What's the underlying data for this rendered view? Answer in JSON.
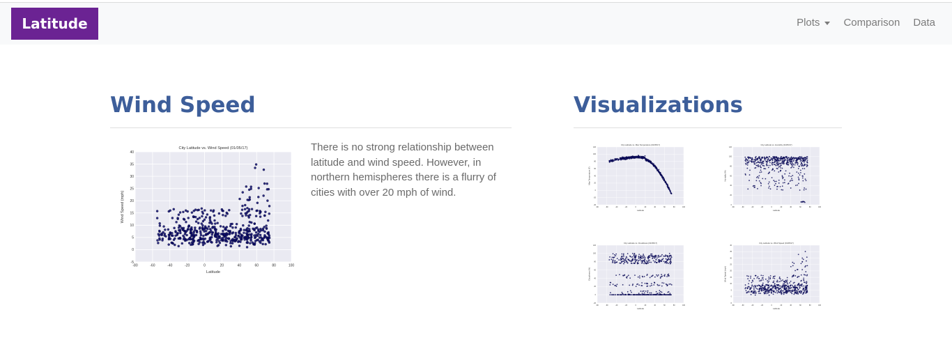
{
  "navbar": {
    "brand": "Latitude",
    "links": [
      {
        "label": "Plots",
        "dropdown": true
      },
      {
        "label": "Comparison",
        "dropdown": false
      },
      {
        "label": "Data",
        "dropdown": false
      }
    ]
  },
  "wind_section": {
    "heading": "Wind Speed",
    "description": "There is no strong relationship between latitude and wind speed. However, in northern hemispheres there is a flurry of cities with over 20 mph of wind."
  },
  "visualizations_section": {
    "heading": "Visualizations"
  },
  "colors": {
    "brand_bg": "#6b2393",
    "heading": "#3d5e9a",
    "plot_bg": "#eaeaf2",
    "marker": "#0b0b6e"
  },
  "chart_data": [
    {
      "id": "wind-main",
      "type": "scatter",
      "title": "City Latitude vs. Wind Speed (01/05/17)",
      "xlabel": "Latitude",
      "ylabel": "Wind Speed (mph)",
      "xlim": [
        -80,
        100
      ],
      "ylim": [
        -5,
        40
      ],
      "xticks": [
        "-80",
        "-60",
        "-40",
        "-20",
        "0",
        "20",
        "40",
        "60",
        "80",
        "100"
      ],
      "yticks": [
        "-5",
        "0",
        "5",
        "10",
        "15",
        "20",
        "25",
        "30",
        "35",
        "40"
      ],
      "grid": true,
      "pattern": "wind"
    },
    {
      "id": "temp-thumb",
      "type": "scatter",
      "title": "City Latitude vs. Max Temperature (01/05/17)",
      "xlabel": "Latitude",
      "ylabel": "Max Temperature (F)",
      "xlim": [
        -80,
        100
      ],
      "ylim": [
        -40,
        120
      ],
      "xticks": [
        "-80",
        "-60",
        "-40",
        "-20",
        "0",
        "20",
        "40",
        "60",
        "80",
        "100"
      ],
      "yticks": [
        "-40",
        "-20",
        "0",
        "20",
        "40",
        "60",
        "80",
        "100",
        "120"
      ],
      "grid": true,
      "pattern": "temp"
    },
    {
      "id": "humidity-thumb",
      "type": "scatter",
      "title": "City Latitude vs. Humidity (01/05/17)",
      "xlabel": "Latitude",
      "ylabel": "Humidity (%)",
      "xlim": [
        -80,
        100
      ],
      "ylim": [
        0,
        120
      ],
      "xticks": [
        "-80",
        "-60",
        "-40",
        "-20",
        "0",
        "20",
        "40",
        "60",
        "80",
        "100"
      ],
      "yticks": [
        "0",
        "20",
        "40",
        "60",
        "80",
        "100",
        "120"
      ],
      "grid": true,
      "pattern": "humidity"
    },
    {
      "id": "cloud-thumb",
      "type": "scatter",
      "title": "City Latitude vs. Cloudiness (01/05/17)",
      "xlabel": "Latitude",
      "ylabel": "Cloudiness (%)",
      "xlim": [
        -80,
        100
      ],
      "ylim": [
        -20,
        120
      ],
      "xticks": [
        "-80",
        "-60",
        "-40",
        "-20",
        "0",
        "20",
        "40",
        "60",
        "80",
        "100"
      ],
      "yticks": [
        "-20",
        "0",
        "20",
        "40",
        "60",
        "80",
        "100",
        "120"
      ],
      "grid": true,
      "pattern": "cloud"
    },
    {
      "id": "wind-thumb",
      "type": "scatter",
      "title": "City Latitude vs. Wind Speed (01/05/17)",
      "xlabel": "Latitude",
      "ylabel": "Wind Speed (mph)",
      "xlim": [
        -80,
        100
      ],
      "ylim": [
        -5,
        40
      ],
      "xticks": [
        "-80",
        "-60",
        "-40",
        "-20",
        "0",
        "20",
        "40",
        "60",
        "80",
        "100"
      ],
      "yticks": [
        "-5",
        "0",
        "5",
        "10",
        "15",
        "20",
        "25",
        "30",
        "35",
        "40"
      ],
      "grid": true,
      "pattern": "wind"
    }
  ]
}
